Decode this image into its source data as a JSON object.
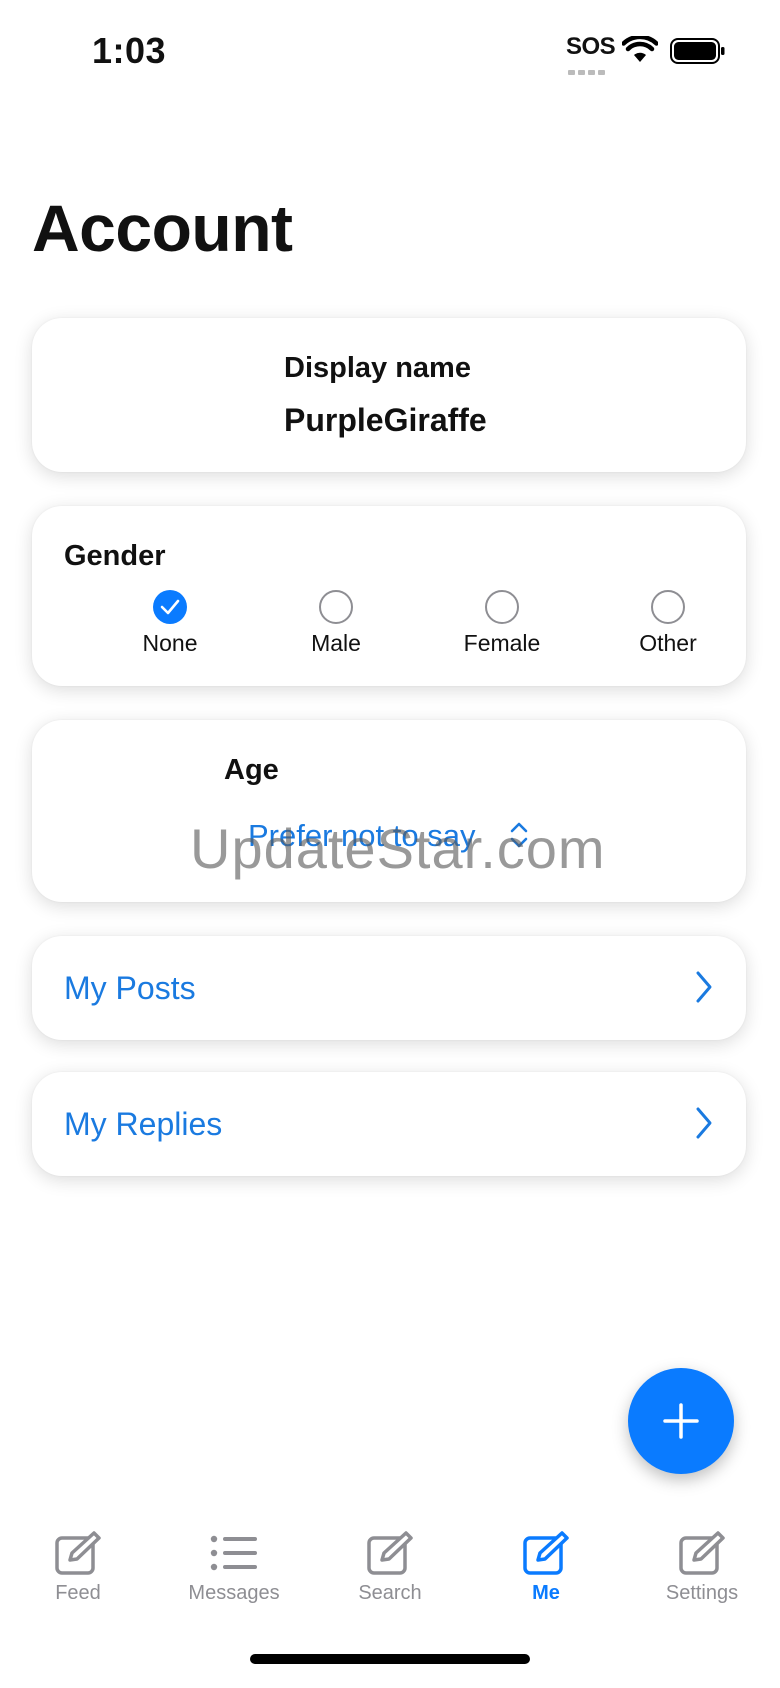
{
  "status_bar": {
    "time": "1:03",
    "sos": "SOS"
  },
  "page_title": "Account",
  "display_name": {
    "label": "Display name",
    "value": "PurpleGiraffe"
  },
  "gender": {
    "label": "Gender",
    "options": [
      {
        "label": "None",
        "selected": true
      },
      {
        "label": "Male",
        "selected": false
      },
      {
        "label": "Female",
        "selected": false
      },
      {
        "label": "Other",
        "selected": false
      }
    ]
  },
  "age": {
    "label": "Age",
    "value": "Prefer not to say"
  },
  "links": {
    "my_posts": "My Posts",
    "my_replies": "My Replies"
  },
  "watermark": "UpdateStar.com",
  "tabs": [
    {
      "label": "Feed",
      "icon": "compose-icon",
      "active": false
    },
    {
      "label": "Messages",
      "icon": "list-icon",
      "active": false
    },
    {
      "label": "Search",
      "icon": "compose-icon",
      "active": false
    },
    {
      "label": "Me",
      "icon": "compose-icon",
      "active": true
    },
    {
      "label": "Settings",
      "icon": "compose-icon",
      "active": false
    }
  ],
  "colors": {
    "accent": "#0a7bff",
    "link": "#1a7ae0",
    "inactive": "#8e8e93"
  }
}
